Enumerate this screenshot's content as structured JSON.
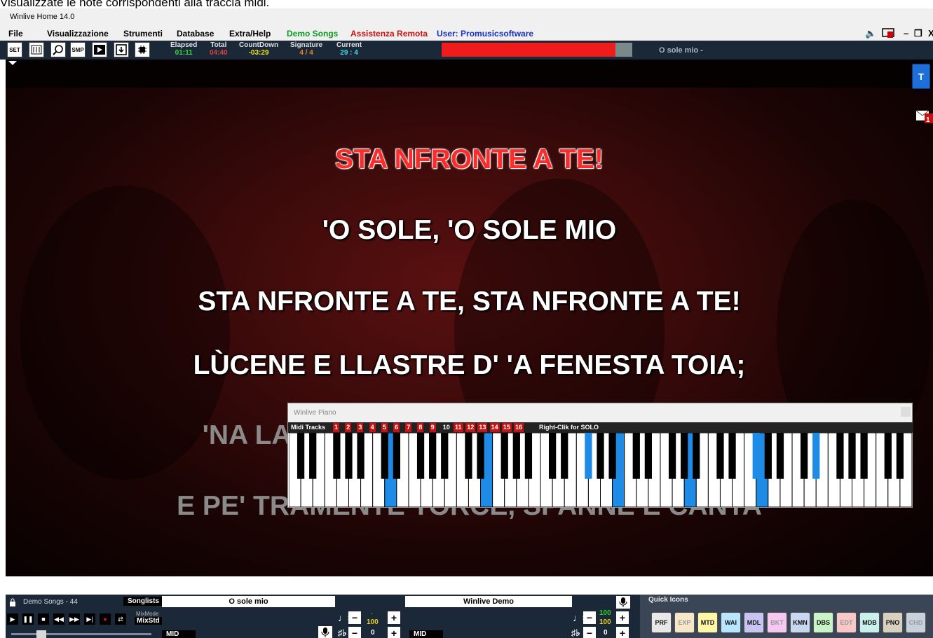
{
  "top_caption": "Visualizzate le note corrispondenti alla traccia midi.",
  "window": {
    "title": "Winlive Home 14.0"
  },
  "menu": {
    "file": "File",
    "view": "Visualizzazione",
    "tools": "Strumenti",
    "database": "Database",
    "extra": "Extra/Help",
    "demo": "Demo Songs",
    "remote": "Assistenza Remota",
    "user": "User: Promusicsoftware"
  },
  "colors": {
    "demo": "#0a9a20",
    "remote": "#cc1010",
    "user": "#1a30c0",
    "toolbar_bg": "#1b2838",
    "accent_blue": "#1e6fd9"
  },
  "toolbar": {
    "buttons": [
      {
        "label": "SET",
        "icon": "folder-set-icon"
      },
      {
        "label": "",
        "icon": "mixer-icon"
      },
      {
        "label": "",
        "icon": "search-icon"
      },
      {
        "label": "SMP",
        "icon": "sample-icon"
      },
      {
        "label": "",
        "icon": "play-video-icon"
      },
      {
        "label": "",
        "icon": "export-icon"
      },
      {
        "label": "",
        "icon": "chip-icon"
      }
    ],
    "elapsed_label": "Elapsed",
    "elapsed": "01:11",
    "total_label": "Total",
    "total": "04:40",
    "countdown_label": "CountDown",
    "countdown": "-03:29",
    "signature_label": "Signature",
    "signature": "4 / 4",
    "current_label": "Current",
    "current": "29 : 4",
    "progress": 0.91,
    "song": "O sole mio -"
  },
  "lyrics": {
    "current": "STA NFRONTE A TE!",
    "lines": [
      "'O SOLE, 'O SOLE MIO",
      "STA NFRONTE A TE, STA NFRONTE A TE!",
      "LÙCENE E LLASTRE D' 'A FENESTA TOIA;"
    ],
    "dim_lines": [
      "'NA LAVANNARA CANTA E SE NE VANTA",
      "E PE' TRAMENTE TORCE, SPANNE E CANTA"
    ]
  },
  "side": {
    "t_button": "T",
    "msg_count": "1"
  },
  "piano": {
    "title": "Winlive Piano",
    "tracks_label": "Midi Tracks",
    "tracks": [
      "1",
      "2",
      "3",
      "4",
      "5",
      "6",
      "7",
      "8",
      "9",
      "10",
      "11",
      "12",
      "13",
      "14",
      "15",
      "16"
    ],
    "inactive_track": "10",
    "solo_hint": "Right-Clik for SOLO",
    "white_pressed": [
      8,
      16,
      27,
      33,
      39
    ],
    "black_pressed": [
      17,
      27,
      31
    ]
  },
  "bottom": {
    "playlist": "Demo Songs - 44",
    "songlists": "Songlists",
    "mix_mode": "MixMode",
    "mix_std": "MixStd",
    "deck_a": {
      "title": "O sole mio",
      "format": "MID",
      "tempo": "100",
      "tempo_hint": "-",
      "transpose": "0"
    },
    "deck_b": {
      "title": "Winlive Demo",
      "format": "MID",
      "tempo": "100",
      "tempo_hint": "100",
      "transpose": "0"
    },
    "quick_icons_label": "Quick Icons",
    "quick_icons": [
      {
        "label": "PRF",
        "color": "#e8e8e8",
        "dim": false
      },
      {
        "label": "EXP",
        "color": "#f8e6c8",
        "dim": true
      },
      {
        "label": "MTD",
        "color": "#fff6a8",
        "dim": false
      },
      {
        "label": "WAI",
        "color": "#b8e6ff",
        "dim": false
      },
      {
        "label": "MDL",
        "color": "#c8c4f4",
        "dim": false
      },
      {
        "label": "BKT",
        "color": "#f4c8f0",
        "dim": true
      },
      {
        "label": "KMN",
        "color": "#c8d8f0",
        "dim": false
      },
      {
        "label": "DBS",
        "color": "#c8f4c8",
        "dim": false
      },
      {
        "label": "EDT",
        "color": "#f8c8c8",
        "dim": true
      },
      {
        "label": "MDB",
        "color": "#c8f0ec",
        "dim": false
      },
      {
        "label": "PNO",
        "color": "#d8d0c0",
        "dim": false
      },
      {
        "label": "CHD",
        "color": "#c8d0dc",
        "dim": true
      }
    ]
  }
}
